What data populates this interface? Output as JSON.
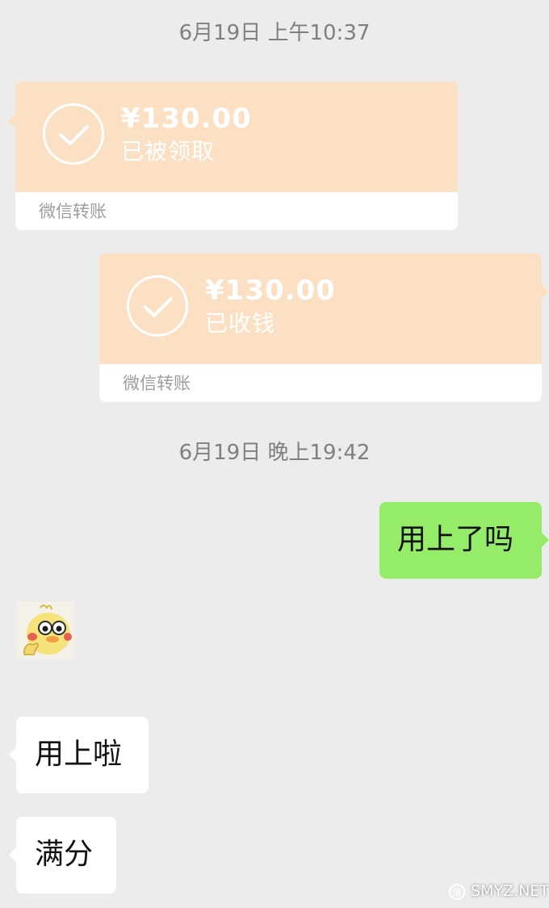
{
  "timestamps": {
    "first": "6月19日 上午10:37",
    "second": "6月19日 晚上19:42"
  },
  "transfers": [
    {
      "amount": "¥130.00",
      "status": "已被领取",
      "brand": "微信转账",
      "side": "left"
    },
    {
      "amount": "¥130.00",
      "status": "已收钱",
      "brand": "微信转账",
      "side": "right"
    }
  ],
  "messages": [
    {
      "text": "用上了吗",
      "side": "right"
    },
    {
      "text": "用上啦",
      "side": "left"
    },
    {
      "text": "满分",
      "side": "left"
    }
  ],
  "sticker": {
    "icon": "duck-thumbs-up-sticker"
  },
  "watermark": {
    "text": "SMYZ.NET"
  },
  "colors": {
    "background": "#ececec",
    "transfer_orange": "#fbe0c3",
    "outgoing_bubble": "#95ec69",
    "incoming_bubble": "#ffffff",
    "timestamp": "#7f7f7f"
  }
}
